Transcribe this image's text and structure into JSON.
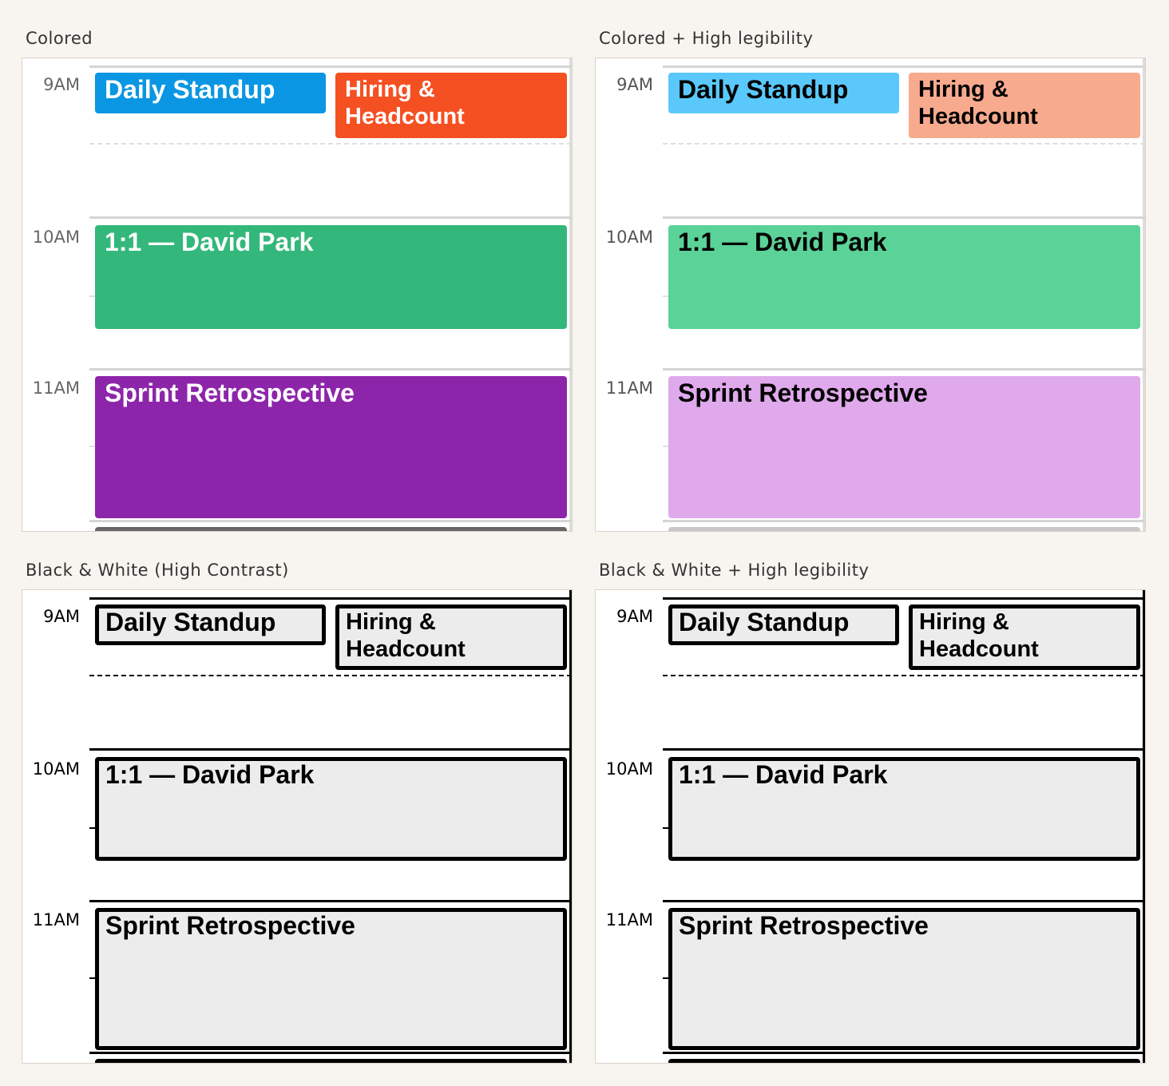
{
  "panels": [
    {
      "label": "Colored",
      "times": [
        "9AM",
        "10AM",
        "11AM"
      ]
    },
    {
      "label": "Colored + High legibility",
      "times": [
        "9AM",
        "10AM",
        "11AM"
      ]
    },
    {
      "label": "Black & White (High Contrast)",
      "times": [
        "9AM",
        "10AM",
        "11AM"
      ]
    },
    {
      "label": "Black & White + High legibility",
      "times": [
        "9AM",
        "10AM",
        "11AM"
      ]
    }
  ],
  "events": {
    "daily_standup": "Daily Standup",
    "hiring_line1": "Hiring &",
    "hiring_line2": "Headcount",
    "one_on_one": "1:1 — David Park",
    "sprint_retro": "Sprint Retrospective"
  },
  "colors": {
    "colored": {
      "daily_standup": "#0a96e2",
      "hiring": "#f55022",
      "one_on_one": "#34b77b",
      "sprint_retro": "#8d25aa",
      "next_event": "#666666"
    },
    "colored_high_legibility": {
      "daily_standup": "#5ac8fb",
      "hiring": "#f7aa8e",
      "one_on_one": "#5ad298",
      "sprint_retro": "#dfa9eb",
      "next_event": "#c7c7c7"
    },
    "black_white": {
      "fill": "#ececec",
      "border": "#000000"
    }
  }
}
